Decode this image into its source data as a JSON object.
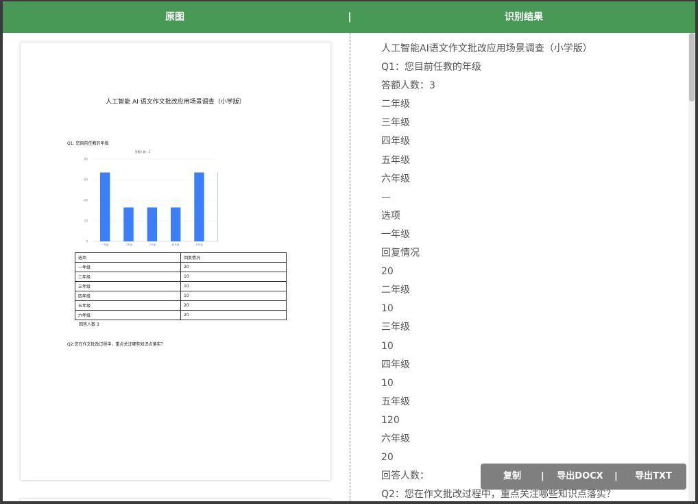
{
  "header": {
    "left_title": "原图",
    "separator": "|",
    "right_title": "识别结果"
  },
  "document": {
    "title": "人工智能 AI 语文作文批改应用场景调查（小学版）",
    "q1": "Q1: 您目前任教的年级",
    "chart_title": "答题人数：3",
    "table_headers": [
      "选项",
      "回复情况"
    ],
    "table_rows": [
      [
        "一年级",
        "20"
      ],
      [
        "二年级",
        "10"
      ],
      [
        "三年级",
        "10"
      ],
      [
        "四年级",
        "10"
      ],
      [
        "五年级",
        "20"
      ],
      [
        "六年级",
        "20"
      ]
    ],
    "answer_count": "回答人数 3",
    "q2": "Q2:您在作文批改过程中，重点关注哪些知识点落实？"
  },
  "chart_data": {
    "type": "bar",
    "title": "答题人数：3",
    "categories": [
      "一年级",
      "二年级",
      "三年级",
      "四年级",
      "五年级",
      "六年级"
    ],
    "values": [
      0.67,
      0.33,
      0.33,
      0.33,
      0.67,
      0.67
    ],
    "y_ticks": [
      "0",
      "20",
      "40",
      "60",
      "80"
    ],
    "ylim": [
      0,
      0.8
    ],
    "grid": true,
    "bar_color": "#3c7ef7"
  },
  "result_lines": [
    "人工智能AI语文作文批改应用场景调查（小学版）",
    "Q1：您目前任教的年级",
    "答额人数：3",
    "二年级",
    "三年级",
    "四年级",
    "五年级",
    "六年级",
    "—",
    "选项",
    "一年级",
    "回复情况",
    "20",
    "二年级",
    "10",
    "三年级",
    "10",
    "四年级",
    "10",
    "五年级",
    "120",
    "六年级",
    "20",
    "回答人数：",
    "Q2：您在作文批改过程中，重点关注哪些知识点落实？"
  ],
  "actions": {
    "copy": "复制",
    "export_docx": "导出DOCX",
    "export_txt": "导出TXT",
    "separator": "|"
  },
  "colors": {
    "header_bg": "#479955",
    "action_bar_bg": "#7f7f7f",
    "result_text": "#555555"
  }
}
